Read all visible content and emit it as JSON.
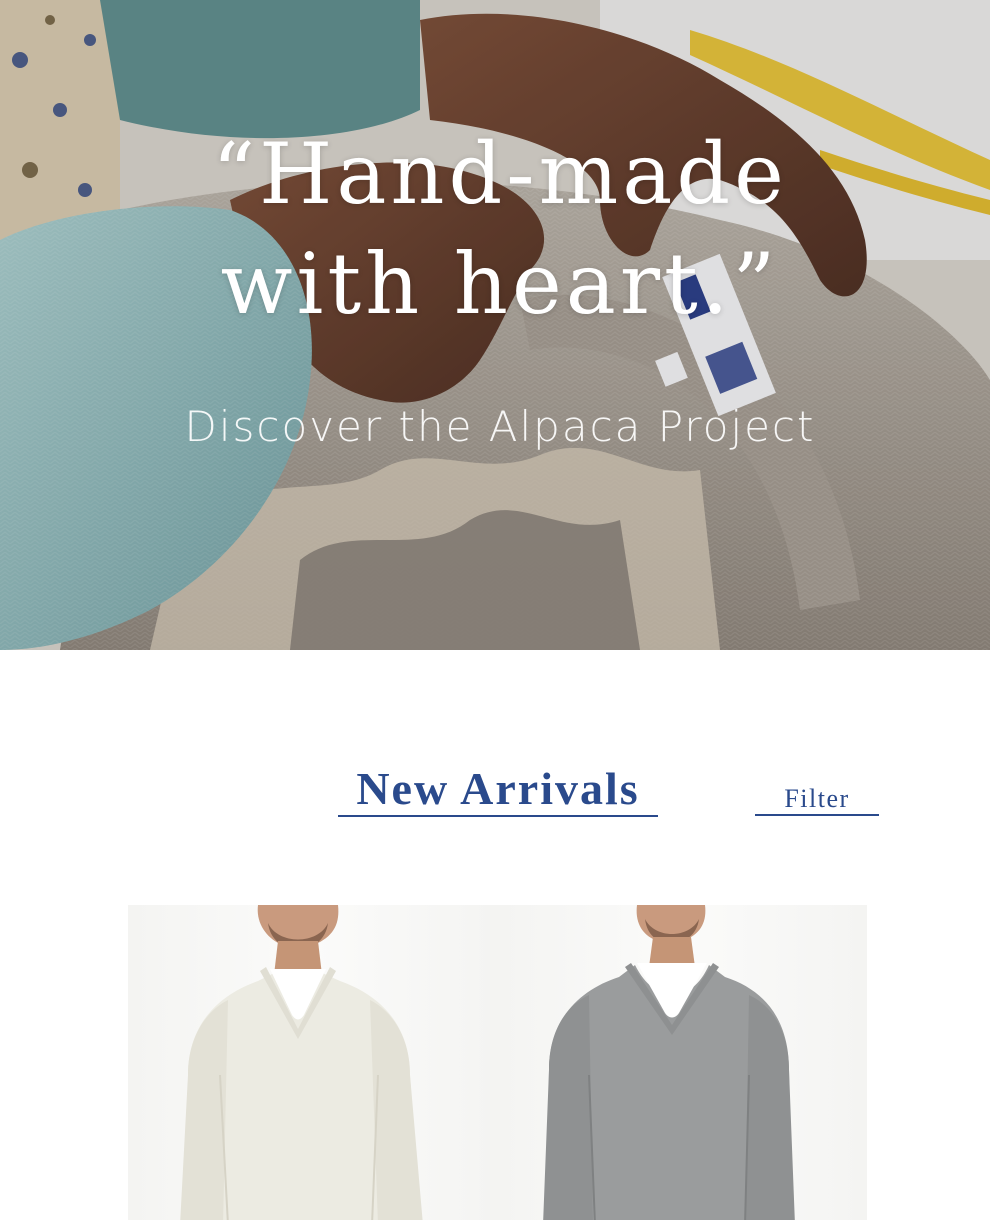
{
  "hero": {
    "quote_line1": "“Hand-made",
    "quote_line2": "with heart.”",
    "subtitle": "Discover the Alpaca Project"
  },
  "arrivals": {
    "title": "New Arrivals",
    "filter_label": "Filter"
  },
  "products": [
    {
      "sweater_color": "#ecebe2",
      "image": "man wearing cream v-neck alpaca sweater"
    },
    {
      "sweater_color": "#9a9c9d",
      "image": "man wearing grey v-neck alpaca sweater"
    }
  ],
  "colors": {
    "accent": "#2a4a8c",
    "hero_text": "#ffffff"
  }
}
